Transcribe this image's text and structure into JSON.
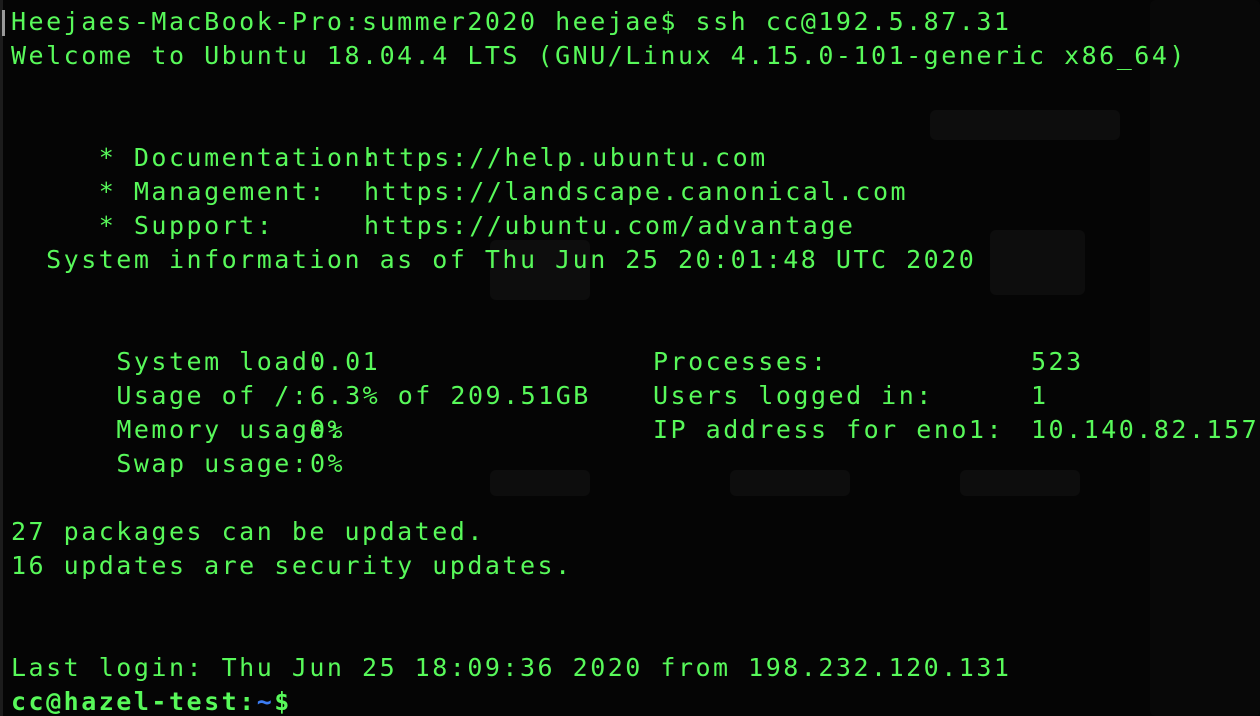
{
  "terminal": {
    "local_prompt": "Heejaes-MacBook-Pro:summer2020 heejae$",
    "command": "ssh cc@192.5.87.31",
    "welcome": "Welcome to Ubuntu 18.04.4 LTS (GNU/Linux 4.15.0-101-generic x86_64)",
    "links": [
      {
        "label": " * Documentation:",
        "url": "https://help.ubuntu.com"
      },
      {
        "label": " * Management:",
        "url": "https://landscape.canonical.com"
      },
      {
        "label": " * Support:",
        "url": "https://ubuntu.com/advantage"
      }
    ],
    "sysinfo_header": "  System information as of Thu Jun 25 20:01:48 UTC 2020",
    "stats_left": [
      {
        "label": "  System load:",
        "value": "0.01"
      },
      {
        "label": "  Usage of /:",
        "value": "6.3% of 209.51GB"
      },
      {
        "label": "  Memory usage:",
        "value": "0%"
      },
      {
        "label": "  Swap usage:",
        "value": "0%"
      }
    ],
    "stats_right": [
      {
        "label": "Processes:",
        "value": "523"
      },
      {
        "label": "Users logged in:",
        "value": "1"
      },
      {
        "label": "IP address for eno1:",
        "value": "10.140.82.157"
      }
    ],
    "updates": [
      "27 packages can be updated.",
      "16 updates are security updates."
    ],
    "last_login": "Last login: Thu Jun 25 18:09:36 2020 from 198.232.120.131",
    "remote_prompt": {
      "user_host": "cc@hazel-test",
      "separator": ":",
      "path": "~",
      "symbol": "$"
    }
  },
  "colors": {
    "text": "#58f95a",
    "path": "#3c7cf3",
    "background": "#050505"
  }
}
